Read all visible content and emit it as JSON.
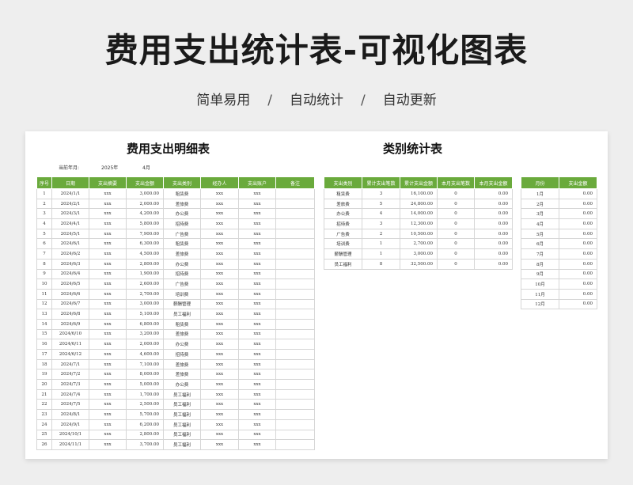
{
  "header": {
    "title": "费用支出统计表-可视化图表",
    "tags": [
      "简单易用",
      "自动统计",
      "自动更新"
    ],
    "sep": "/"
  },
  "detail": {
    "title": "费用支出明细表",
    "period_label": "当前年月:",
    "year": "2025年",
    "month": "4月",
    "columns": [
      "序号",
      "日期",
      "支出摘要",
      "支出金额",
      "支出类别",
      "经办人",
      "支出账户",
      "备注"
    ],
    "rows": [
      [
        "1",
        "2024/1/1",
        "xxx",
        "3,000.00",
        "租赁费",
        "xxx",
        "xxx",
        ""
      ],
      [
        "2",
        "2024/2/1",
        "xxx",
        "2,000.00",
        "差旅费",
        "xxx",
        "xxx",
        ""
      ],
      [
        "3",
        "2024/3/1",
        "xxx",
        "4,200.00",
        "办公费",
        "xxx",
        "xxx",
        ""
      ],
      [
        "4",
        "2024/4/1",
        "xxx",
        "5,800.00",
        "招待费",
        "xxx",
        "xxx",
        ""
      ],
      [
        "5",
        "2024/5/1",
        "xxx",
        "7,900.00",
        "广告费",
        "xxx",
        "xxx",
        ""
      ],
      [
        "6",
        "2024/6/1",
        "xxx",
        "6,300.00",
        "租赁费",
        "xxx",
        "xxx",
        ""
      ],
      [
        "7",
        "2024/6/2",
        "xxx",
        "4,500.00",
        "差旅费",
        "xxx",
        "xxx",
        ""
      ],
      [
        "8",
        "2024/6/3",
        "xxx",
        "2,800.00",
        "办公费",
        "xxx",
        "xxx",
        ""
      ],
      [
        "9",
        "2024/6/4",
        "xxx",
        "1,900.00",
        "招待费",
        "xxx",
        "xxx",
        ""
      ],
      [
        "10",
        "2024/6/5",
        "xxx",
        "2,600.00",
        "广告费",
        "xxx",
        "xxx",
        ""
      ],
      [
        "11",
        "2024/6/6",
        "xxx",
        "2,700.00",
        "培训费",
        "xxx",
        "xxx",
        ""
      ],
      [
        "12",
        "2024/6/7",
        "xxx",
        "3,000.00",
        "薪酬管理",
        "xxx",
        "xxx",
        ""
      ],
      [
        "13",
        "2024/6/8",
        "xxx",
        "5,100.00",
        "员工福利",
        "xxx",
        "xxx",
        ""
      ],
      [
        "14",
        "2024/6/9",
        "xxx",
        "6,800.00",
        "租赁费",
        "xxx",
        "xxx",
        ""
      ],
      [
        "15",
        "2024/6/10",
        "xxx",
        "3,200.00",
        "差旅费",
        "xxx",
        "xxx",
        ""
      ],
      [
        "16",
        "2024/6/11",
        "xxx",
        "2,000.00",
        "办公费",
        "xxx",
        "xxx",
        ""
      ],
      [
        "17",
        "2024/6/12",
        "xxx",
        "4,600.00",
        "招待费",
        "xxx",
        "xxx",
        ""
      ],
      [
        "18",
        "2024/7/1",
        "xxx",
        "7,100.00",
        "差旅费",
        "xxx",
        "xxx",
        ""
      ],
      [
        "19",
        "2024/7/2",
        "xxx",
        "8,000.00",
        "差旅费",
        "xxx",
        "xxx",
        ""
      ],
      [
        "20",
        "2024/7/3",
        "xxx",
        "5,000.00",
        "办公费",
        "xxx",
        "xxx",
        ""
      ],
      [
        "21",
        "2024/7/4",
        "xxx",
        "1,700.00",
        "员工福利",
        "xxx",
        "xxx",
        ""
      ],
      [
        "22",
        "2024/7/5",
        "xxx",
        "2,500.00",
        "员工福利",
        "xxx",
        "xxx",
        ""
      ],
      [
        "23",
        "2024/8/1",
        "xxx",
        "5,700.00",
        "员工福利",
        "xxx",
        "xxx",
        ""
      ],
      [
        "24",
        "2024/9/1",
        "xxx",
        "6,200.00",
        "员工福利",
        "xxx",
        "xxx",
        ""
      ],
      [
        "25",
        "2024/10/1",
        "xxx",
        "2,800.00",
        "员工福利",
        "xxx",
        "xxx",
        ""
      ],
      [
        "26",
        "2024/11/1",
        "xxx",
        "3,700.00",
        "员工福利",
        "xxx",
        "xxx",
        ""
      ]
    ]
  },
  "category": {
    "title": "类别统计表",
    "columns": [
      "支出类别",
      "累计支出笔数",
      "累计支出金额",
      "本月支出笔数",
      "本月支出金额"
    ],
    "rows": [
      [
        "租赁费",
        "3",
        "16,100.00",
        "0",
        "0.00"
      ],
      [
        "差旅费",
        "5",
        "24,800.00",
        "0",
        "0.00"
      ],
      [
        "办公费",
        "4",
        "14,000.00",
        "0",
        "0.00"
      ],
      [
        "招待费",
        "3",
        "12,300.00",
        "0",
        "0.00"
      ],
      [
        "广告费",
        "2",
        "10,500.00",
        "0",
        "0.00"
      ],
      [
        "培训费",
        "1",
        "2,700.00",
        "0",
        "0.00"
      ],
      [
        "薪酬管理",
        "1",
        "3,000.00",
        "0",
        "0.00"
      ],
      [
        "员工福利",
        "8",
        "32,500.00",
        "0",
        "0.00"
      ]
    ]
  },
  "monthly": {
    "columns": [
      "月份",
      "支出金额"
    ],
    "rows": [
      [
        "1月",
        "0.00"
      ],
      [
        "2月",
        "0.00"
      ],
      [
        "3月",
        "0.00"
      ],
      [
        "4月",
        "0.00"
      ],
      [
        "5月",
        "0.00"
      ],
      [
        "6月",
        "0.00"
      ],
      [
        "7月",
        "0.00"
      ],
      [
        "8月",
        "0.00"
      ],
      [
        "9月",
        "0.00"
      ],
      [
        "10月",
        "0.00"
      ],
      [
        "11月",
        "0.00"
      ],
      [
        "12月",
        "0.00"
      ]
    ]
  },
  "colors": {
    "header_green": "#6aaa3c",
    "grid": "#d6d6d6"
  }
}
